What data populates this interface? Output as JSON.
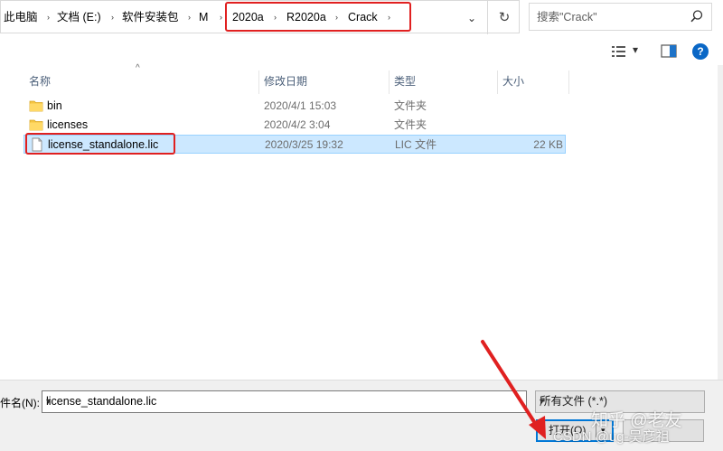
{
  "address_bar": {
    "crumbs": [
      "此电脑",
      "文档 (E:)",
      "软件安装包",
      "M",
      "2020a",
      "R2020a",
      "Crack"
    ],
    "separator": "›",
    "dropdown": "⌄",
    "refresh": "↻"
  },
  "search": {
    "placeholder": "搜索\"Crack\""
  },
  "toolbar": {
    "view_dropdown": "▾",
    "help": "?"
  },
  "columns": {
    "name": "名称",
    "date": "修改日期",
    "type": "类型",
    "size": "大小",
    "sort_indicator": "^"
  },
  "files": [
    {
      "name": "bin",
      "date": "2020/4/1 15:03",
      "type": "文件夹",
      "size": "",
      "icon": "folder-icon"
    },
    {
      "name": "licenses",
      "date": "2020/4/2 3:04",
      "type": "文件夹",
      "size": "",
      "icon": "folder-icon"
    },
    {
      "name": "license_standalone.lic",
      "date": "2020/3/25 19:32",
      "type": "LIC 文件",
      "size": "22 KB",
      "icon": "file-icon",
      "selected": true
    }
  ],
  "footer": {
    "filename_label": "件名(N):",
    "filename_value": "license_standalone.lic",
    "filter_value": "所有文件 (*.*)",
    "open_label": "打开(O)",
    "dropdown": "▾"
  },
  "watermark": {
    "line1": "知乎 @老友",
    "line2": "CSDN @ug-吴彦祖"
  },
  "colors": {
    "highlight": "#e02020",
    "selection": "#cce8ff",
    "accent": "#0078d7"
  }
}
